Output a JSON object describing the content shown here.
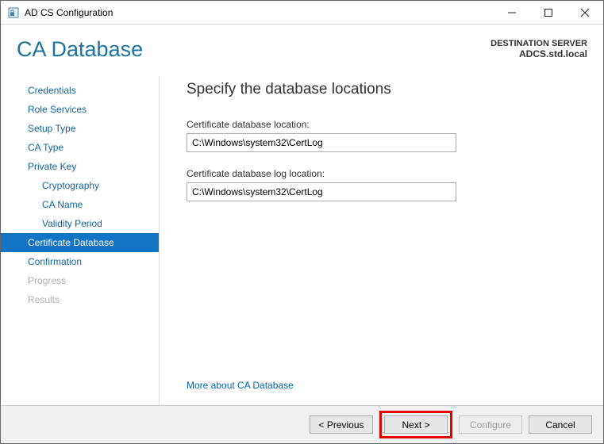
{
  "window": {
    "title": "AD CS Configuration"
  },
  "header": {
    "page_title": "CA Database",
    "destination_label": "DESTINATION SERVER",
    "destination_name": "ADCS.std.local"
  },
  "sidebar": {
    "items": [
      {
        "label": "Credentials",
        "indent": false,
        "selected": false,
        "disabled": false
      },
      {
        "label": "Role Services",
        "indent": false,
        "selected": false,
        "disabled": false
      },
      {
        "label": "Setup Type",
        "indent": false,
        "selected": false,
        "disabled": false
      },
      {
        "label": "CA Type",
        "indent": false,
        "selected": false,
        "disabled": false
      },
      {
        "label": "Private Key",
        "indent": false,
        "selected": false,
        "disabled": false
      },
      {
        "label": "Cryptography",
        "indent": true,
        "selected": false,
        "disabled": false
      },
      {
        "label": "CA Name",
        "indent": true,
        "selected": false,
        "disabled": false
      },
      {
        "label": "Validity Period",
        "indent": true,
        "selected": false,
        "disabled": false
      },
      {
        "label": "Certificate Database",
        "indent": false,
        "selected": true,
        "disabled": false
      },
      {
        "label": "Confirmation",
        "indent": false,
        "selected": false,
        "disabled": false
      },
      {
        "label": "Progress",
        "indent": false,
        "selected": false,
        "disabled": true
      },
      {
        "label": "Results",
        "indent": false,
        "selected": false,
        "disabled": true
      }
    ]
  },
  "main": {
    "heading": "Specify the database locations",
    "db_label": "Certificate database location:",
    "db_value": "C:\\Windows\\system32\\CertLog",
    "log_label": "Certificate database log location:",
    "log_value": "C:\\Windows\\system32\\CertLog",
    "more_link": "More about CA Database"
  },
  "footer": {
    "previous": "< Previous",
    "next": "Next >",
    "configure": "Configure",
    "cancel": "Cancel"
  }
}
